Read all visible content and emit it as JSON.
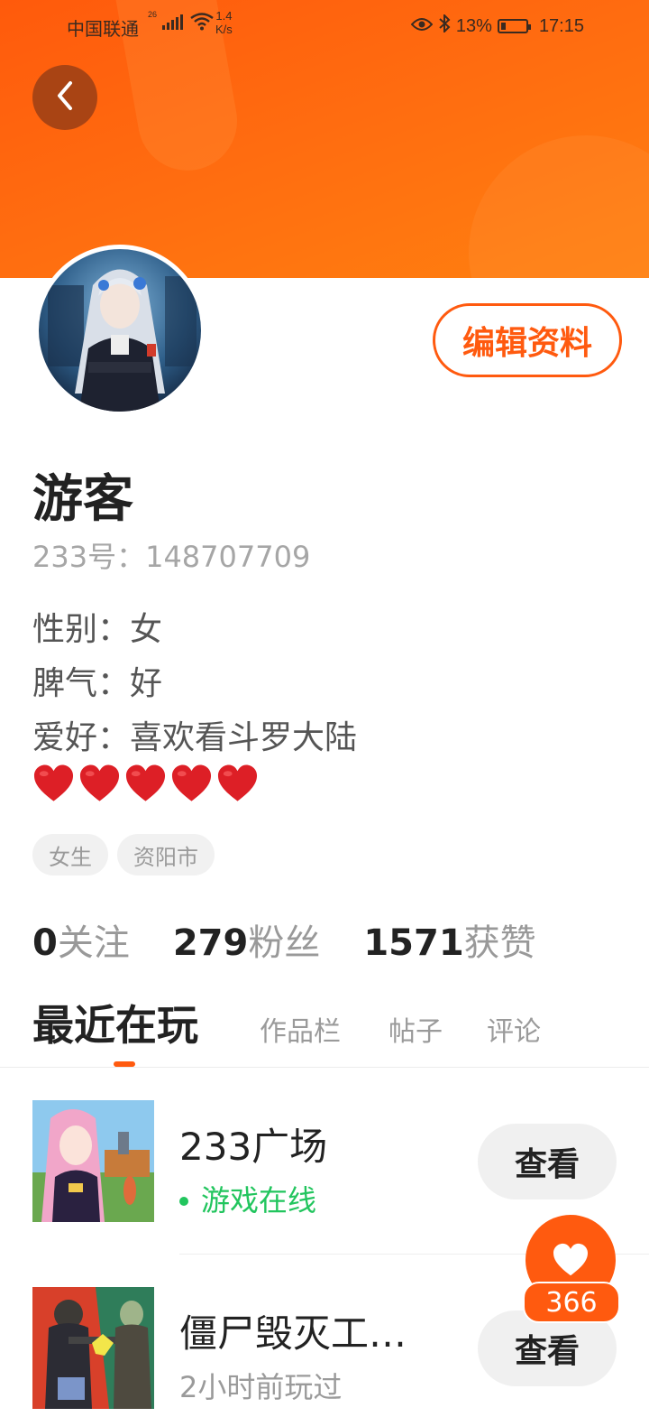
{
  "status_bar": {
    "carrier": "中国联通",
    "network_badge": "26",
    "net_speed_value": "1.4",
    "net_speed_unit": "K/s",
    "battery_percent": "13%",
    "time": "17:15",
    "icons": [
      "signal-icon",
      "wifi-icon",
      "eye-icon",
      "bluetooth-icon",
      "battery-icon"
    ]
  },
  "header": {
    "back_icon": "chevron-left-icon",
    "accent_color": "#ff5a0f"
  },
  "profile": {
    "edit_button": "编辑资料",
    "username": "游客",
    "user_id": "233号：148707709",
    "bio_lines": [
      "性别：女",
      "脾气：好",
      "爱好：喜欢看斗罗大陆"
    ],
    "hearts": [
      "❤️",
      "❤️",
      "❤️",
      "❤️",
      "❤️"
    ],
    "tags": [
      "女生",
      "资阳市"
    ]
  },
  "stats": [
    {
      "value": "0",
      "label": "关注"
    },
    {
      "value": "279",
      "label": "粉丝"
    },
    {
      "value": "1571",
      "label": "获赞"
    }
  ],
  "tabs": [
    {
      "label": "最近在玩",
      "active": true
    },
    {
      "label": "作品栏",
      "active": false
    },
    {
      "label": "帖子",
      "active": false
    },
    {
      "label": "评论",
      "active": false
    }
  ],
  "games": [
    {
      "title": "233广场",
      "status": "游戏在线",
      "online": true,
      "button": "查看"
    },
    {
      "title": "僵尸毁灭工…",
      "status": "2小时前玩过",
      "online": false,
      "button": "查看"
    }
  ],
  "like_fab": {
    "count": "366",
    "icon": "heart-icon"
  }
}
